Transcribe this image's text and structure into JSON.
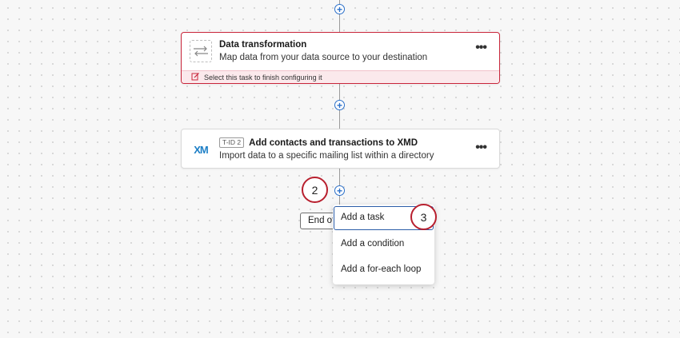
{
  "cards": [
    {
      "title": "Data transformation",
      "subtitle": "Map data from your data source to your destination",
      "footer": "Select this task to finish configuring it",
      "icon": "arrows-left-right-icon",
      "menu_label": "•••",
      "status_color": "#c8253a"
    },
    {
      "badge": "T-ID 2",
      "title": "Add contacts and transactions to XMD",
      "subtitle": "Import data to a specific mailing list within a directory",
      "logo": "XM",
      "menu_label": "•••"
    }
  ],
  "plus_label": "+",
  "end_label": "End of",
  "dropdown": {
    "items": [
      "Add a task",
      "Add a condition",
      "Add a for-each loop"
    ]
  },
  "steps": [
    "2",
    "3"
  ],
  "colors": {
    "accent": "#2a6fc9",
    "step_ring": "#b81f2e",
    "error": "#c8253a"
  }
}
